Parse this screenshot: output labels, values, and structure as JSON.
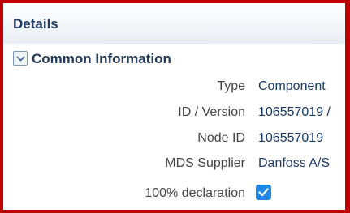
{
  "panel": {
    "title": "Details"
  },
  "section": {
    "title": "Common Information",
    "toggle_icon": "chevron-down-icon",
    "expanded": true
  },
  "fields": [
    {
      "label": "Type",
      "value": "Component"
    },
    {
      "label": "ID / Version",
      "value": "106557019 /"
    },
    {
      "label": "Node ID",
      "value": "106557019"
    },
    {
      "label": "MDS Supplier",
      "value": "Danfoss A/S"
    },
    {
      "label": "100% declaration",
      "checked": true
    }
  ],
  "colors": {
    "frame_border": "#c00000",
    "title": "#1f3d66",
    "value_text": "#1a3a66",
    "checkbox": "#1e88e5"
  }
}
